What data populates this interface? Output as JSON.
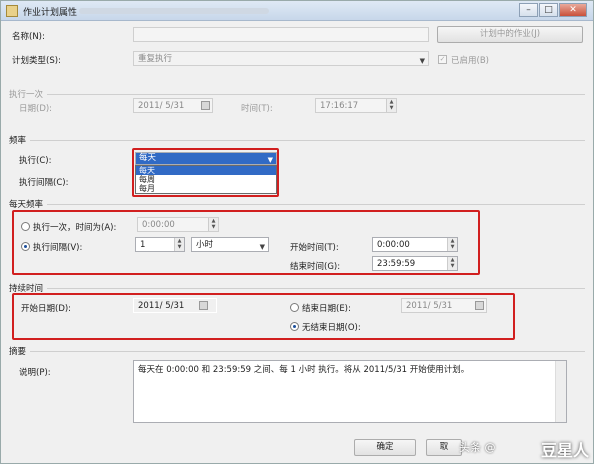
{
  "window": {
    "title": "作业计划属性 -"
  },
  "titlebar_buttons": {
    "min": "–",
    "max": "□",
    "close": "✕"
  },
  "name": {
    "label": "名称(N):",
    "value": "",
    "jobs_button": "计划中的作业(J)"
  },
  "schedule_type": {
    "label": "计划类型(S):",
    "value": "重复执行",
    "enabled_label": "已启用(B)",
    "enabled_checked": true
  },
  "one_time": {
    "section": "执行一次",
    "date_label": "日期(D):",
    "date_value": "2011/ 5/31",
    "time_label": "时间(T):",
    "time_value": "17:16:17"
  },
  "frequency": {
    "section": "频率",
    "exec_label": "执行(C):",
    "exec_value": "每天",
    "options": [
      "每天",
      "每周",
      "每月"
    ],
    "selected_index": 0,
    "interval_label": "执行间隔(C):"
  },
  "daily": {
    "section": "每天频率",
    "once_label": "执行一次，时间为(A):",
    "once_time": "0:00:00",
    "interval_label": "执行间隔(V):",
    "interval_value": "1",
    "interval_unit": "小时",
    "start_label": "开始时间(T):",
    "start_value": "0:00:00",
    "end_label": "结束时间(G):",
    "end_value": "23:59:59"
  },
  "duration": {
    "section": "持续时间",
    "start_label": "开始日期(D):",
    "start_value": "2011/ 5/31",
    "end_label": "结束日期(E):",
    "end_value": "2011/ 5/31",
    "no_end_label": "无结束日期(O):"
  },
  "summary": {
    "section": "摘要",
    "desc_label": "说明(P):",
    "desc_value": "每天在 0:00:00 和 23:59:59 之间、每 1 小时 执行。将从 2011/5/31 开始使用计划。"
  },
  "buttons": {
    "ok": "确定",
    "cancel": "取"
  },
  "watermark": {
    "small": "头条 @",
    "big": "豆星人"
  },
  "colors": {
    "highlight_red": "#d11f1f",
    "selection_blue": "#316ac5"
  }
}
